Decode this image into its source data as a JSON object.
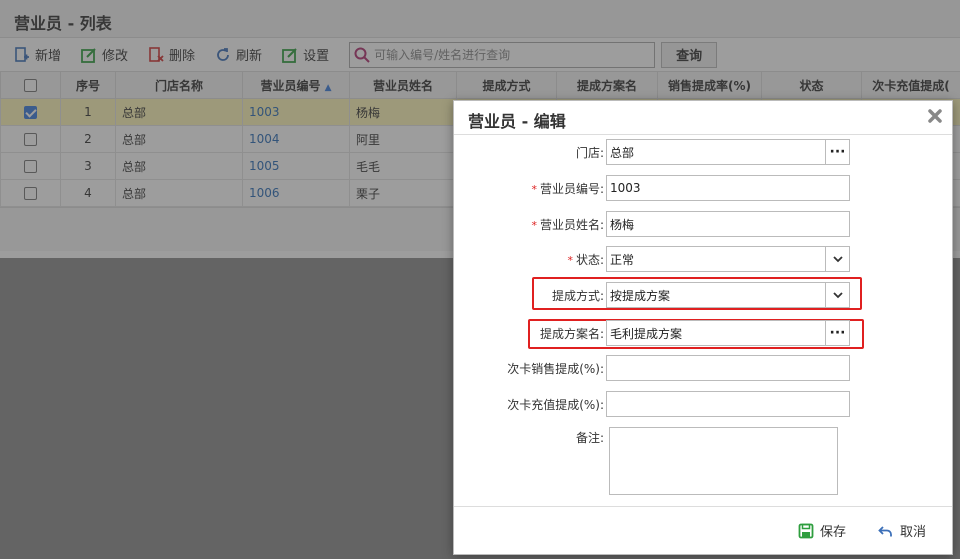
{
  "list": {
    "title": "营业员 - 列表",
    "toolbar": {
      "add": "新增",
      "edit": "修改",
      "delete": "删除",
      "refresh": "刷新",
      "settings": "设置",
      "search_placeholder": "可输入编号/姓名进行查询",
      "query": "查询"
    },
    "columns": [
      "序号",
      "门店名称",
      "营业员编号",
      "营业员姓名",
      "提成方式",
      "提成方案名",
      "销售提成率(%)",
      "状态",
      "次卡充值提成("
    ],
    "rows": [
      {
        "no": "1",
        "store": "总部",
        "code": "1003",
        "name": "杨梅",
        "selected": true
      },
      {
        "no": "2",
        "store": "总部",
        "code": "1004",
        "name": "阿里",
        "selected": false
      },
      {
        "no": "3",
        "store": "总部",
        "code": "1005",
        "name": "毛毛",
        "selected": false
      },
      {
        "no": "4",
        "store": "总部",
        "code": "1006",
        "name": "栗子",
        "selected": false
      }
    ]
  },
  "dialog": {
    "title": "营业员 - 编辑",
    "fields": {
      "store_label": "门店:",
      "store_value": "总部",
      "code_label": "营业员编号:",
      "code_value": "1003",
      "name_label": "营业员姓名:",
      "name_value": "杨梅",
      "status_label": "状态:",
      "status_value": "正常",
      "method_label": "提成方式:",
      "method_value": "按提成方案",
      "plan_label": "提成方案名:",
      "plan_value": "毛利提成方案",
      "card_sale_label": "次卡销售提成(%):",
      "card_sale_value": "",
      "card_recharge_label": "次卡充值提成(%):",
      "card_recharge_value": "",
      "remark_label": "备注:"
    },
    "required_mark": "*",
    "more_glyph": "···",
    "save": "保存",
    "cancel": "取消"
  },
  "colors": {
    "highlight_border": "#e02020",
    "selected_row": "#fff6b8",
    "link_code": "#2a6db8",
    "save_icon": "#2e9e3e",
    "cancel_icon": "#3b6fb8"
  }
}
